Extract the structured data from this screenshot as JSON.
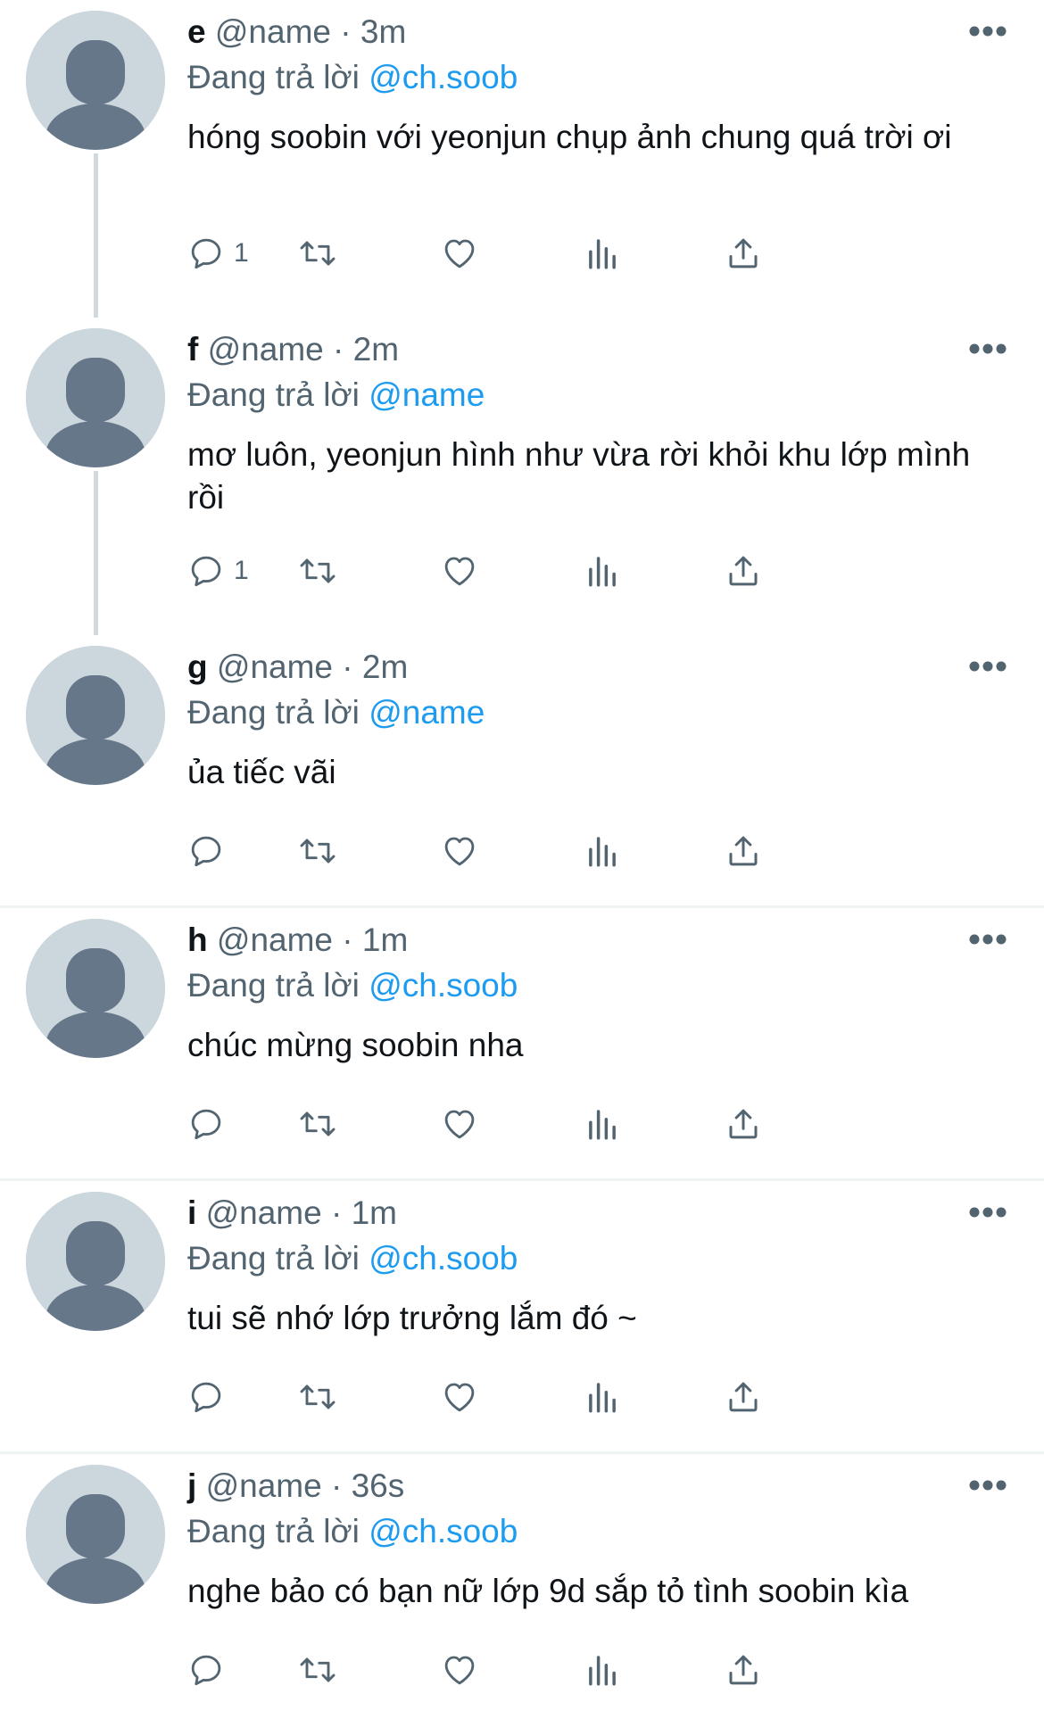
{
  "reply_prefix": "Đang trả lời",
  "tweets": [
    {
      "name": "e",
      "handle": "@name",
      "time": "3m",
      "reply_to": "@ch.soob",
      "text": "hóng soobin với yeonjun chụp ảnh chung quá trời ơi",
      "reply_count": "1"
    },
    {
      "name": "f",
      "handle": "@name",
      "time": "2m",
      "reply_to": "@name",
      "text": "mơ luôn, yeonjun hình như vừa rời khỏi khu lớp mình rồi",
      "reply_count": "1"
    },
    {
      "name": "g",
      "handle": "@name",
      "time": "2m",
      "reply_to": "@name",
      "text": "ủa tiếc vãi",
      "reply_count": ""
    },
    {
      "name": "h",
      "handle": "@name",
      "time": "1m",
      "reply_to": "@ch.soob",
      "text": "chúc mừng soobin nha",
      "reply_count": ""
    },
    {
      "name": "i",
      "handle": "@name",
      "time": "1m",
      "reply_to": "@ch.soob",
      "text": "tui sẽ nhớ lớp trưởng lắm đó ~",
      "reply_count": ""
    },
    {
      "name": "j",
      "handle": "@name",
      "time": "36s",
      "reply_to": "@ch.soob",
      "text": "nghe bảo có bạn nữ lớp 9d sắp tỏ tình soobin kìa",
      "reply_count": ""
    }
  ],
  "icons": {
    "reply": "reply-icon",
    "retweet": "retweet-icon",
    "like": "heart-icon",
    "views": "views-icon",
    "share": "share-icon",
    "more": "more-icon",
    "avatar": "default-avatar-icon"
  },
  "colors": {
    "link": "#1d9bf0",
    "secondary": "#536471",
    "text": "#0f1419",
    "avatar_bg": "#ccd6dd",
    "avatar_fg": "#66778a",
    "thread_line": "#cfd9de",
    "divider": "#eff3f4"
  }
}
